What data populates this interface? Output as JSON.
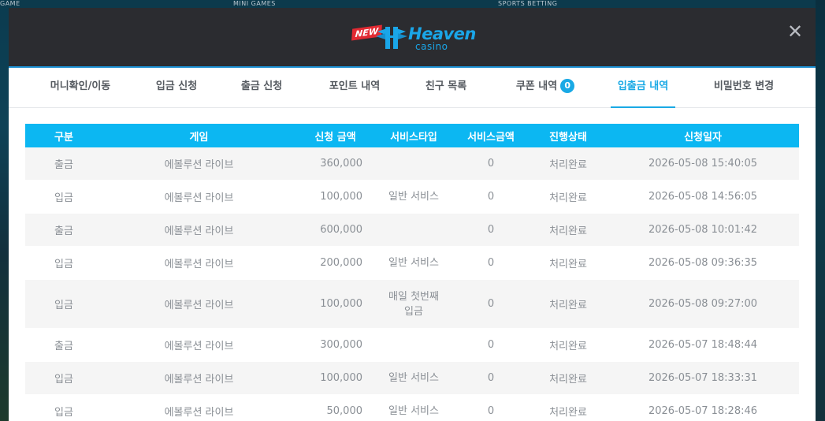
{
  "background": {
    "labels": [
      "GAME",
      "MINI GAMES",
      "SPORTS BETTING"
    ]
  },
  "header": {
    "logo": {
      "new_label": "NEW",
      "brand": "Heaven",
      "sub": "casino"
    },
    "close_label": "✕"
  },
  "tabs": [
    {
      "label": "머니확인/이동"
    },
    {
      "label": "입금 신청"
    },
    {
      "label": "출금 신청"
    },
    {
      "label": "포인트 내역"
    },
    {
      "label": "친구 목록"
    },
    {
      "label": "쿠폰 내역",
      "badge": "0"
    },
    {
      "label": "입출금 내역",
      "active": true
    },
    {
      "label": "비밀번호 변경"
    }
  ],
  "table": {
    "headers": [
      "구분",
      "게임",
      "신청 금액",
      "서비스타입",
      "서비스금액",
      "진행상태",
      "신청일자"
    ],
    "rows": [
      {
        "type": "출금",
        "game": "에볼루션 라이브",
        "amount": "360,000",
        "service_type": "",
        "service_amount": "0",
        "status": "처리완료",
        "date": "2026-05-08 15:40:05"
      },
      {
        "type": "입금",
        "game": "에볼루션 라이브",
        "amount": "100,000",
        "service_type": "일반 서비스",
        "service_amount": "0",
        "status": "처리완료",
        "date": "2026-05-08 14:56:05"
      },
      {
        "type": "출금",
        "game": "에볼루션 라이브",
        "amount": "600,000",
        "service_type": "",
        "service_amount": "0",
        "status": "처리완료",
        "date": "2026-05-08 10:01:42"
      },
      {
        "type": "입금",
        "game": "에볼루션 라이브",
        "amount": "200,000",
        "service_type": "일반 서비스",
        "service_amount": "0",
        "status": "처리완료",
        "date": "2026-05-08 09:36:35"
      },
      {
        "type": "입금",
        "game": "에볼루션 라이브",
        "amount": "100,000",
        "service_type": "매일 첫번째\n입금",
        "service_amount": "0",
        "status": "처리완료",
        "date": "2026-05-08 09:27:00"
      },
      {
        "type": "출금",
        "game": "에볼루션 라이브",
        "amount": "300,000",
        "service_type": "",
        "service_amount": "0",
        "status": "처리완료",
        "date": "2026-05-07 18:48:44"
      },
      {
        "type": "입금",
        "game": "에볼루션 라이브",
        "amount": "100,000",
        "service_type": "일반 서비스",
        "service_amount": "0",
        "status": "처리완료",
        "date": "2026-05-07 18:33:31"
      },
      {
        "type": "입금",
        "game": "에볼루션 라이브",
        "amount": "50,000",
        "service_type": "일반 서비스",
        "service_amount": "0",
        "status": "처리완료",
        "date": "2026-05-07 18:28:46"
      }
    ]
  },
  "colors": {
    "accent": "#0cb7f2",
    "header_bg": "#2b2c30",
    "row_alt": "#f5f5f5",
    "text_muted": "#8a8f95"
  }
}
